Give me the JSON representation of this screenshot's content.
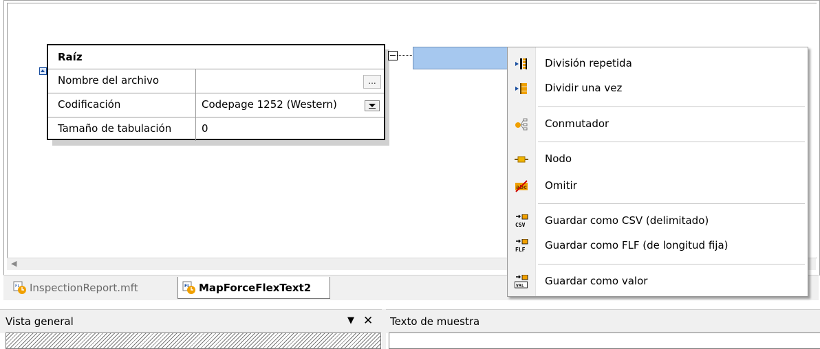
{
  "component": {
    "title": "Raíz",
    "rows": [
      {
        "label": "Nombre del archivo",
        "value": "",
        "button": "..."
      },
      {
        "label": "Codificación",
        "value": "Codepage 1252 (Western)"
      },
      {
        "label": "Tamaño de tabulación",
        "value": "0"
      }
    ]
  },
  "tabs": [
    {
      "label": "InspectionReport.mft",
      "active": false
    },
    {
      "label": "MapForceFlexText2",
      "active": true
    }
  ],
  "panes": {
    "left_title": "Vista general",
    "left_menu_glyph": "▼",
    "left_close_glyph": "✕",
    "right_title": "Texto de muestra"
  },
  "scroll": {
    "left_arrow": "◀"
  },
  "context_menu": {
    "items": [
      {
        "label": "División repetida",
        "icon": "split-repeated-icon"
      },
      {
        "label": "Dividir una vez",
        "icon": "split-once-icon"
      },
      {
        "label": "Conmutador",
        "icon": "switch-icon"
      },
      {
        "label": "Nodo",
        "icon": "node-icon"
      },
      {
        "label": "Omitir",
        "icon": "ignore-icon"
      },
      {
        "label": "Guardar como CSV (delimitado)",
        "icon": "store-csv-icon",
        "icon_text": "CSV"
      },
      {
        "label": "Guardar como FLF (de longitud fija)",
        "icon": "store-flf-icon",
        "icon_text": "FLF"
      },
      {
        "label": "Guardar como valor",
        "icon": "store-value-icon",
        "icon_text": "VAL"
      }
    ]
  },
  "colors": {
    "node_fill": "#a6c8ef",
    "icon_orange": "#f0a000",
    "icon_blue": "#1a4fa0"
  }
}
